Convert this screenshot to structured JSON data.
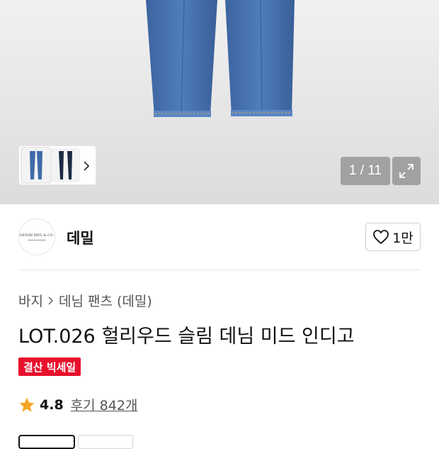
{
  "gallery": {
    "counter": "1 / 11",
    "current_image": 1,
    "total_images": 11
  },
  "brand": {
    "logo_text": "DENIM MFG & CO.",
    "name": "데밀",
    "like_count": "1만"
  },
  "breadcrumb": {
    "items": [
      "바지",
      "데님 팬츠 (데밀)"
    ]
  },
  "product": {
    "title": "LOT.026 헐리우드 슬림 데님 미드 인디고",
    "badge": "결산 빅세일",
    "rating": "4.8",
    "reviews": "후기 842개"
  },
  "colors": {
    "badge": "#e8112d",
    "star": "#f5a623",
    "denim": "#3f6aa8"
  }
}
